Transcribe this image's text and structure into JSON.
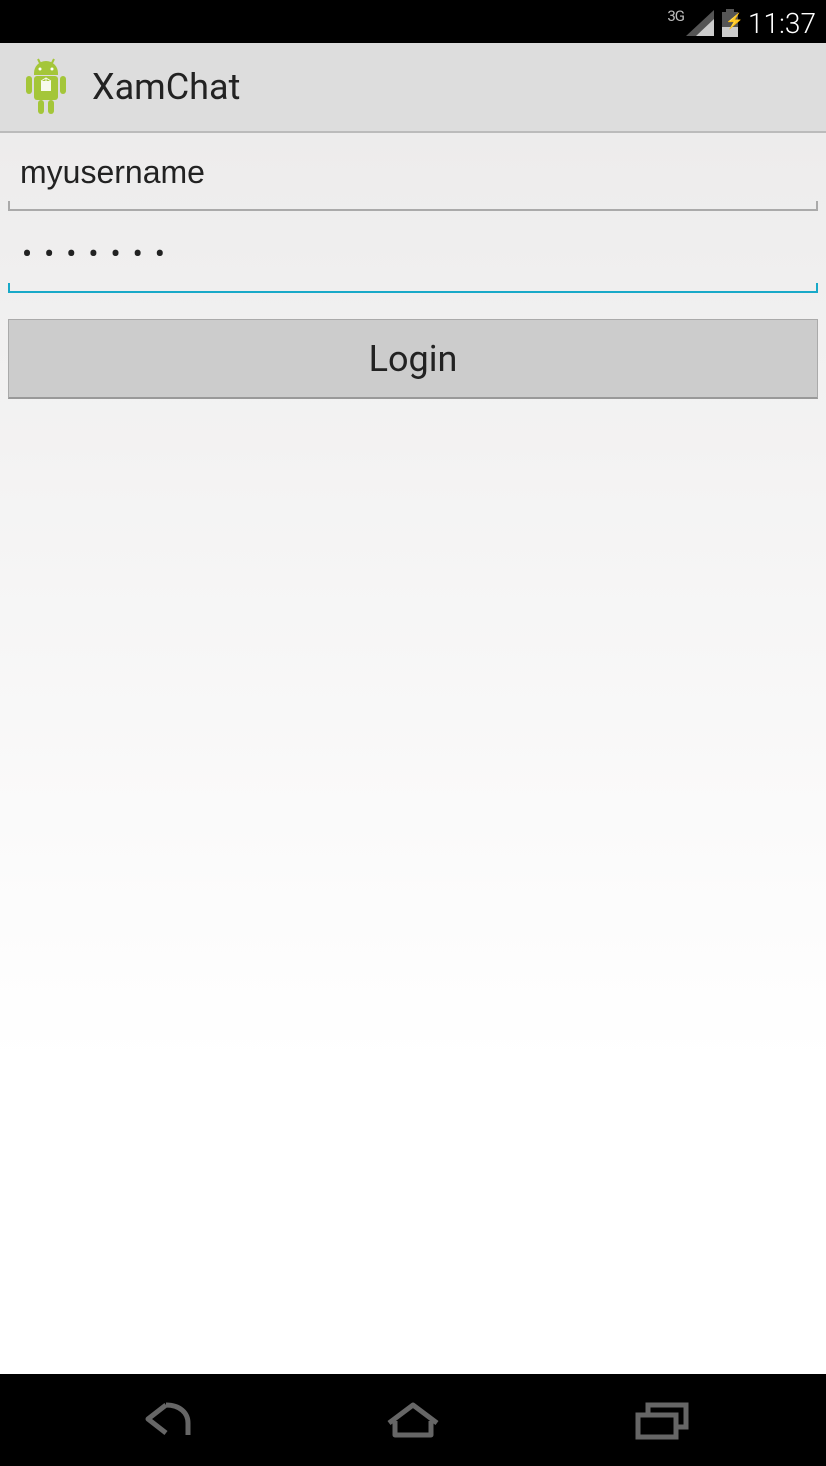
{
  "status_bar": {
    "network_label": "3G",
    "clock": "11:37"
  },
  "action_bar": {
    "title": "XamChat"
  },
  "login_form": {
    "username_value": "myusername",
    "password_dots": "•••••••",
    "login_button_label": "Login"
  }
}
